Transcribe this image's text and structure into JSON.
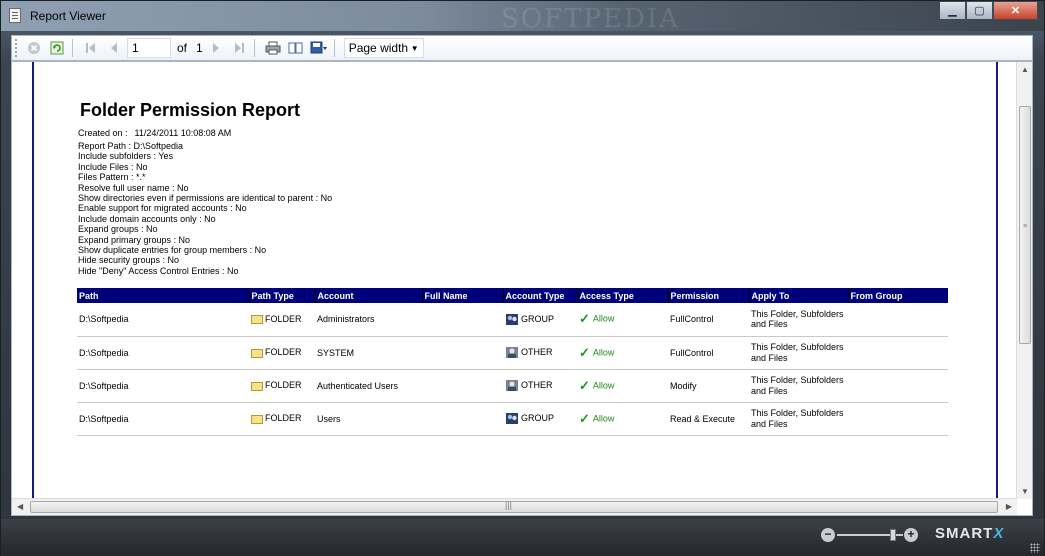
{
  "window": {
    "title": "Report Viewer",
    "watermark": "SOFTPEDIA",
    "controls": {
      "minimize": "▁",
      "maximize": "▢",
      "close": "✕"
    }
  },
  "toolbar": {
    "stop_icon": "stop-icon",
    "refresh_icon": "refresh-icon",
    "first_icon": "first-page-icon",
    "prev_icon": "previous-page-icon",
    "page_value": "1",
    "of_label": "of",
    "total_pages": "1",
    "next_icon": "next-page-icon",
    "last_icon": "last-page-icon",
    "print_icon": "print-icon",
    "page_setup_icon": "page-setup-icon",
    "export_icon": "save-icon",
    "zoom_value": "Page width"
  },
  "report": {
    "title": "Folder Permission Report",
    "created_label": "Created on :",
    "created_value": "11/24/2011 10:08:08 AM",
    "params": [
      "Report Path : D:\\Softpedia",
      "Include subfolders : Yes",
      "Include Files : No",
      "Files Pattern : *.*",
      "Resolve full user name : No",
      "Show directories even if permissions are identical to parent : No",
      "Enable support for migrated accounts : No",
      "Include domain accounts only : No",
      "Expand groups : No",
      "Expand primary groups : No",
      "Show duplicate entries for group members : No",
      "Hide security groups : No",
      "Hide \"Deny\" Access Control Entries : No"
    ],
    "columns": [
      "Path",
      "Path Type",
      "Account",
      "Full Name",
      "Account Type",
      "Access Type",
      "Permission",
      "Apply To",
      "From Group"
    ],
    "rows": [
      {
        "path": "D:\\Softpedia",
        "path_type": "FOLDER",
        "account": "Administrators",
        "full_name": "",
        "account_type": "GROUP",
        "access_type": "Allow",
        "permission": "FullControl",
        "apply_to_1": "This Folder, Subfolders",
        "apply_to_2": "and Files",
        "from_group": ""
      },
      {
        "path": "D:\\Softpedia",
        "path_type": "FOLDER",
        "account": "SYSTEM",
        "full_name": "",
        "account_type": "OTHER",
        "access_type": "Allow",
        "permission": "FullControl",
        "apply_to_1": "This Folder, Subfolders",
        "apply_to_2": "and Files",
        "from_group": ""
      },
      {
        "path": "D:\\Softpedia",
        "path_type": "FOLDER",
        "account": "Authenticated Users",
        "full_name": "",
        "account_type": "OTHER",
        "access_type": "Allow",
        "permission": "Modify",
        "apply_to_1": "This Folder, Subfolders",
        "apply_to_2": "and Files",
        "from_group": ""
      },
      {
        "path": "D:\\Softpedia",
        "path_type": "FOLDER",
        "account": "Users",
        "full_name": "",
        "account_type": "GROUP",
        "access_type": "Allow",
        "permission": "Read & Execute",
        "apply_to_1": "This Folder, Subfolders",
        "apply_to_2": "and Files",
        "from_group": ""
      }
    ]
  },
  "statusbar": {
    "zoom_level": 0.85,
    "brand": "SMART",
    "brand_x": "X"
  },
  "colors": {
    "table_header": "#00007a",
    "allow": "#1a9a1a",
    "page_border": "#1a1a7a"
  }
}
